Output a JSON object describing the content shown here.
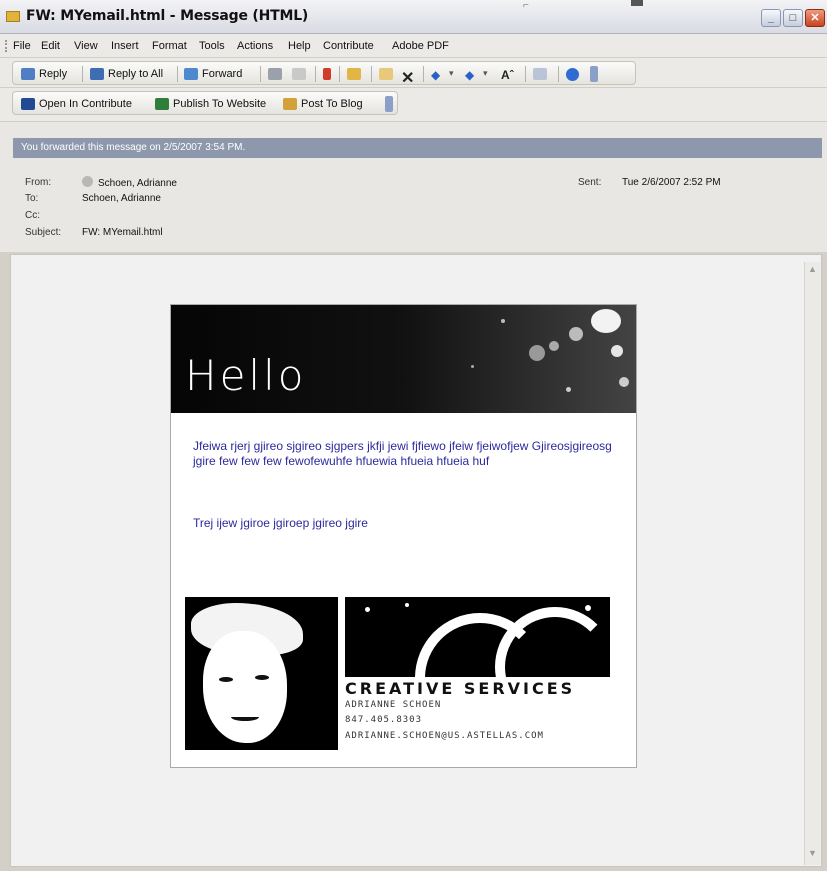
{
  "window": {
    "title": "FW: MYemail.html - Message (HTML)",
    "minimize": "_",
    "maximize": "□",
    "close": "✕",
    "cursor_glyph": "⌐"
  },
  "menu": [
    "File",
    "Edit",
    "View",
    "Insert",
    "Format",
    "Tools",
    "Actions",
    "Help",
    "Contribute",
    "Adobe PDF"
  ],
  "toolbar1": {
    "reply": "Reply",
    "reply_all": "Reply to All",
    "forward": "Forward",
    "delete_glyph": "✕",
    "up_glyph": "◆",
    "down_glyph": "▾",
    "font_glyph": "Aˆ"
  },
  "toolbar2": {
    "open_contribute": "Open In Contribute",
    "publish": "Publish To Website",
    "post_blog": "Post To Blog"
  },
  "header": {
    "info": "You forwarded this message on 2/5/2007 3:54 PM.",
    "from_label": "From:",
    "from_value": "Schoen, Adrianne",
    "to_label": "To:",
    "to_value": "Schoen, Adrianne",
    "cc_label": "Cc:",
    "subject_label": "Subject:",
    "subject_value": "FW: MYemail.html",
    "sent_label": "Sent:",
    "sent_value": "Tue 2/6/2007 2:52 PM"
  },
  "email": {
    "greeting": "Hello",
    "paragraph1": "Jfeiwa rjerj gjireo sjgireo sjgpers jkfji jewi fjfiewo jfeiw fjeiwofjew Gjireosjgireosg jgire few few few fewofewuhfe hfuewia hfueia hfueia huf",
    "paragraph2": "Trej ijew jgiroe jgiroep jgireo jgire",
    "signature": {
      "title": "CREATIVE SERVICES",
      "name": "ADRIANNE SCHOEN",
      "phone": "847.405.8303",
      "email": "ADRIANNE.SCHOEN@US.ASTELLAS.COM"
    }
  },
  "colors": {
    "infobar": "#8d98ac",
    "email_text": "#2c2a9c",
    "close_button": "#c8431f"
  }
}
